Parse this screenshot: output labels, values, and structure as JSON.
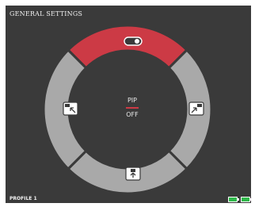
{
  "header": {
    "title": "GENERAL SETTINGS"
  },
  "footer": {
    "profile_label": "PROFILE 1"
  },
  "center": {
    "mode_on": "PIP",
    "mode_off": "OFF"
  },
  "segments": [
    {
      "position": "top",
      "icon": "toggle-switch-icon",
      "selected": true
    },
    {
      "position": "right",
      "icon": "pip-top-right-icon",
      "selected": false
    },
    {
      "position": "bottom",
      "icon": "pip-bottom-center-icon",
      "selected": false
    },
    {
      "position": "left",
      "icon": "pip-bottom-left-icon",
      "selected": false
    }
  ],
  "status": {
    "battery_left": "battery-full-icon",
    "battery_right": "battery-full-icon"
  },
  "colors": {
    "selected": "#cc3a45",
    "segment": "#a9a9a9",
    "background": "#3a3a3a",
    "divider": "#3a3a3a"
  }
}
